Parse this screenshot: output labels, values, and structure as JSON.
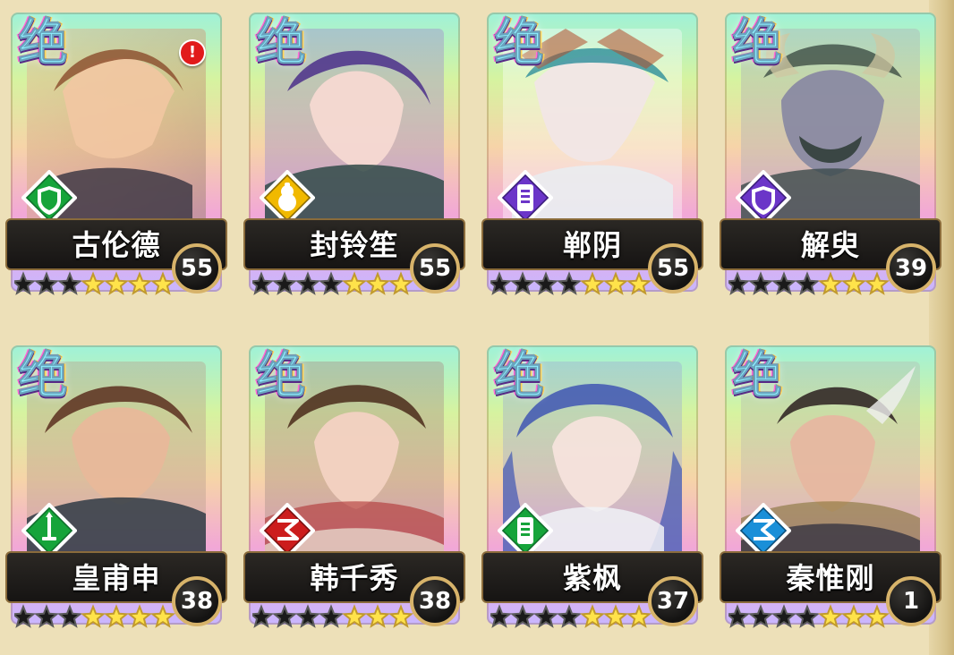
{
  "heroes": [
    {
      "rarity": "绝",
      "name": "古伦德",
      "level": "55",
      "stars_filled": 4,
      "stars_total": 7,
      "class_icon": "shield-icon",
      "badge_color": "#16a43a",
      "has_alert": true,
      "alert_text": "!"
    },
    {
      "rarity": "绝",
      "name": "封铃笙",
      "level": "55",
      "stars_filled": 3,
      "stars_total": 7,
      "class_icon": "gourd-icon",
      "badge_color": "#f1b900",
      "has_alert": false,
      "alert_text": ""
    },
    {
      "rarity": "绝",
      "name": "郸阴",
      "level": "55",
      "stars_filled": 3,
      "stars_total": 7,
      "class_icon": "talisman-icon",
      "badge_color": "#6b35c8",
      "has_alert": false,
      "alert_text": ""
    },
    {
      "rarity": "绝",
      "name": "解臾",
      "level": "39",
      "stars_filled": 3,
      "stars_total": 7,
      "class_icon": "shield-icon",
      "badge_color": "#6b35c8",
      "has_alert": false,
      "alert_text": ""
    },
    {
      "rarity": "绝",
      "name": "皇甫申",
      "level": "38",
      "stars_filled": 4,
      "stars_total": 7,
      "class_icon": "sword-icon",
      "badge_color": "#16a43a",
      "has_alert": false,
      "alert_text": ""
    },
    {
      "rarity": "绝",
      "name": "韩千秀",
      "level": "38",
      "stars_filled": 3,
      "stars_total": 7,
      "class_icon": "rune-icon",
      "badge_color": "#cc1d1d",
      "has_alert": false,
      "alert_text": ""
    },
    {
      "rarity": "绝",
      "name": "紫枫",
      "level": "37",
      "stars_filled": 3,
      "stars_total": 7,
      "class_icon": "talisman-icon",
      "badge_color": "#16a43a",
      "has_alert": false,
      "alert_text": ""
    },
    {
      "rarity": "绝",
      "name": "秦惟刚",
      "level": "1",
      "stars_filled": 3,
      "stars_total": 7,
      "class_icon": "rune-icon",
      "badge_color": "#1a8fd8",
      "has_alert": false,
      "alert_text": ""
    }
  ]
}
